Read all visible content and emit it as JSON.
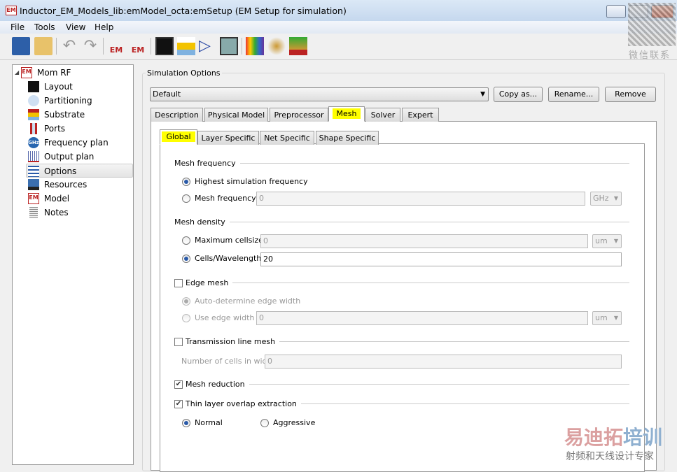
{
  "window": {
    "title": "Inductor_EM_Models_lib:emModel_octa:emSetup (EM Setup for simulation)",
    "app_icon": "EM"
  },
  "menu": [
    "File",
    "Tools",
    "View",
    "Help"
  ],
  "toolbar": {
    "icons": [
      "save-icon",
      "open-icon",
      "undo-icon",
      "redo-icon",
      "em-simulate-icon",
      "em-stop-icon",
      "layout-icon",
      "substrate-icon",
      "amplifier-icon",
      "box-3d-icon",
      "colors-icon",
      "settings-person-icon",
      "pcb-icon"
    ],
    "em_label": "EM"
  },
  "tree": {
    "root": "Mom RF",
    "items": [
      "Layout",
      "Partitioning",
      "Substrate",
      "Ports",
      "Frequency plan",
      "Output plan",
      "Options",
      "Resources",
      "Model",
      "Notes"
    ],
    "selected": "Options"
  },
  "options": {
    "group_title": "Simulation Options",
    "preset": "Default",
    "copy_as": "Copy as...",
    "rename": "Rename...",
    "remove": "Remove",
    "tabs": [
      "Description",
      "Physical Model",
      "Preprocessor",
      "Mesh",
      "Solver",
      "Expert"
    ],
    "active_tab": "Mesh",
    "subtabs": [
      "Global",
      "Layer Specific",
      "Net Specific",
      "Shape Specific"
    ],
    "active_subtab": "Global"
  },
  "mesh": {
    "freq_section": "Mesh frequency",
    "highest": "Highest simulation frequency",
    "mesh_freq": "Mesh frequency",
    "mesh_freq_value": "0",
    "freq_unit": "GHz",
    "density_section": "Mesh density",
    "max_cell": "Maximum cellsize",
    "max_cell_value": "0",
    "max_cell_unit": "um",
    "cells_wl": "Cells/Wavelength",
    "cells_wl_value": "20",
    "edge_mesh": "Edge mesh",
    "auto_edge": "Auto-determine edge width",
    "use_edge": "Use edge width",
    "edge_value": "0",
    "edge_unit": "um",
    "tl_mesh": "Transmission line mesh",
    "num_cells": "Number of cells in width",
    "num_cells_value": "0",
    "mesh_reduction": "Mesh reduction",
    "thin_layer": "Thin layer overlap extraction",
    "normal": "Normal",
    "aggressive": "Aggressive"
  },
  "watermark": {
    "qr_caption": "微信联系",
    "brand_red": "易迪拓",
    "brand_blue": "培训",
    "tagline": "射频和天线设计专家"
  }
}
